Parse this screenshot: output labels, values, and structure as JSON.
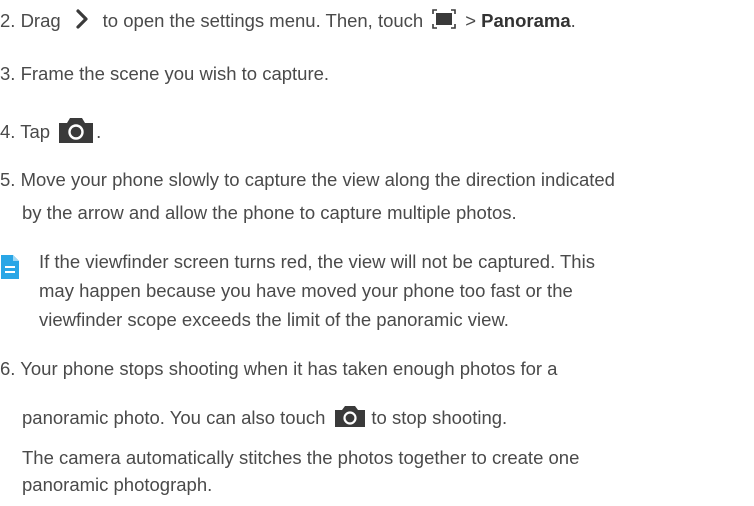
{
  "colors": {
    "text": "#4a4a4a",
    "icon_fill": "#3a3a3a",
    "note_icon": "#29a6e6"
  },
  "icons": [
    "chevron-right-icon",
    "scene-mode-icon",
    "camera-shutter-icon",
    "note-icon"
  ],
  "steps": {
    "s2": {
      "a": "2. Drag",
      "b": "to open the settings menu. Then, touch",
      "c": "> ",
      "bold": "Panorama",
      "d": "."
    },
    "s3": "3. Frame the scene you wish to capture.",
    "s4": {
      "a": "4. Tap",
      "b": "."
    },
    "s5": {
      "l1": "5. Move your phone slowly to capture the view along the direction indicated",
      "l2": "by the arrow and allow the phone to capture multiple photos."
    },
    "note": {
      "l1": "If the viewfinder screen turns red, the view will not be captured. This",
      "l2": "may happen because you have moved your phone too fast or the",
      "l3": "viewfinder scope exceeds the limit of the panoramic view."
    },
    "s6": {
      "l1": "6. Your phone stops shooting when it has taken enough photos for a",
      "l2a": "panoramic photo. You can also touch",
      "l2b": "to stop shooting.",
      "l3": "The camera automatically stitches the photos together to create one",
      "l4": "panoramic photograph."
    }
  }
}
